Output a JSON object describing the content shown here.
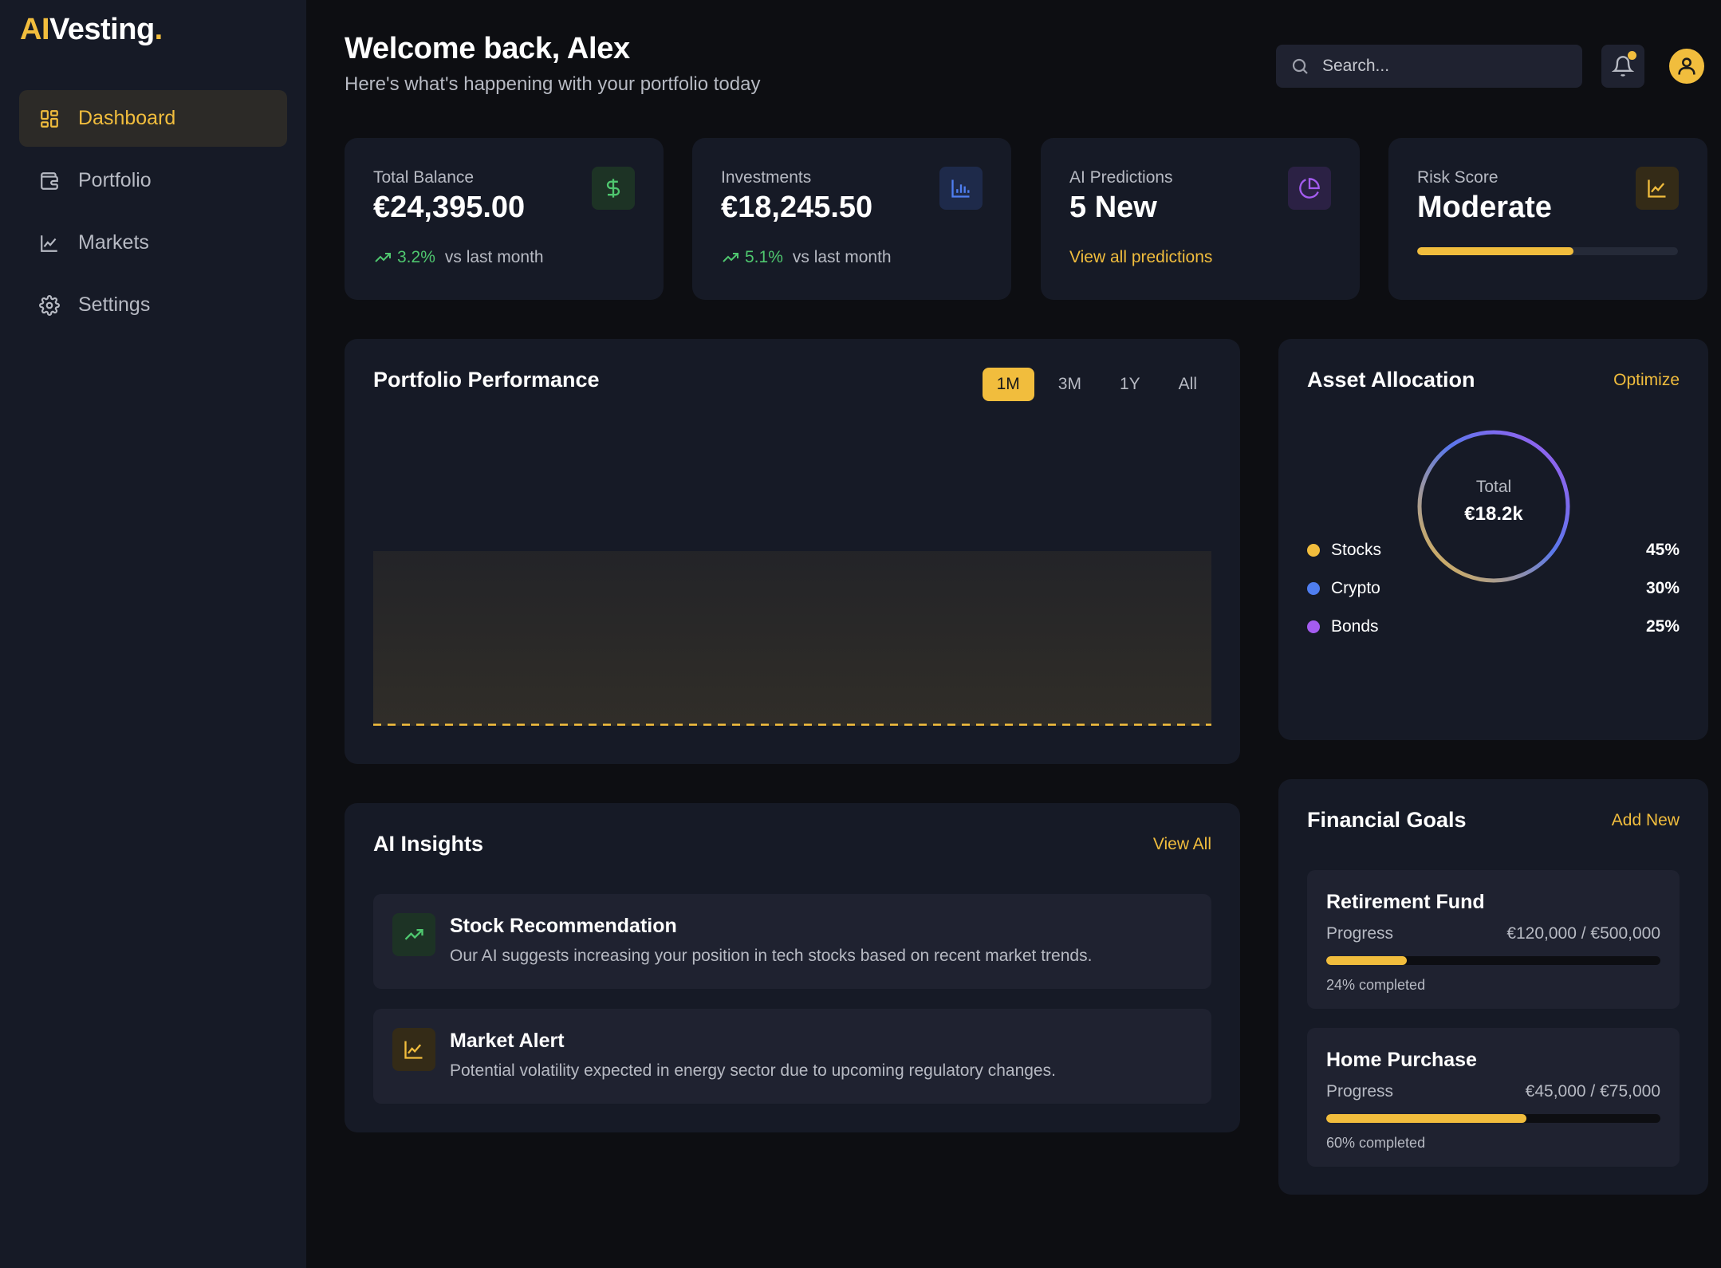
{
  "brand": {
    "prefix": "AI",
    "name": "Vesting",
    "dot": "."
  },
  "nav": {
    "items": [
      {
        "label": "Dashboard",
        "icon": "grid-icon",
        "active": true
      },
      {
        "label": "Portfolio",
        "icon": "wallet-icon",
        "active": false
      },
      {
        "label": "Markets",
        "icon": "line-chart-icon",
        "active": false
      },
      {
        "label": "Settings",
        "icon": "gear-icon",
        "active": false
      }
    ]
  },
  "header": {
    "title": "Welcome back, Alex",
    "subtitle": "Here's what's happening with your portfolio today",
    "search_placeholder": "Search...",
    "has_notification": true
  },
  "stats": {
    "balance": {
      "label": "Total Balance",
      "value": "€24,395.00",
      "change": "3.2%",
      "change_text": "vs last month",
      "icon": "dollar-icon"
    },
    "investments": {
      "label": "Investments",
      "value": "€18,245.50",
      "change": "5.1%",
      "change_text": "vs last month",
      "icon": "bar-chart-icon"
    },
    "predictions": {
      "label": "AI Predictions",
      "value": "5 New",
      "link": "View all predictions",
      "icon": "pie-chart-icon"
    },
    "risk": {
      "label": "Risk Score",
      "value": "Moderate",
      "level": 0.6,
      "icon": "line-chart-icon"
    }
  },
  "performance": {
    "title": "Portfolio Performance",
    "ranges": [
      "1M",
      "3M",
      "1Y",
      "All"
    ],
    "active_range": "1M"
  },
  "insights": {
    "title": "AI Insights",
    "link": "View All",
    "items": [
      {
        "title": "Stock Recommendation",
        "text": "Our AI suggests increasing your position in tech stocks based on recent market trends.",
        "icon": "trend-up-icon"
      },
      {
        "title": "Market Alert",
        "text": "Potential volatility expected in energy sector due to upcoming regulatory changes.",
        "icon": "line-chart-icon"
      }
    ]
  },
  "allocation": {
    "title": "Asset Allocation",
    "link": "Optimize",
    "center_label": "Total",
    "center_value": "€18.2k",
    "items": [
      {
        "name": "Stocks",
        "pct": "45%",
        "color": "#f1bd3d"
      },
      {
        "name": "Crypto",
        "pct": "30%",
        "color": "#4f7ef0"
      },
      {
        "name": "Bonds",
        "pct": "25%",
        "color": "#a45cf0"
      }
    ]
  },
  "goals": {
    "title": "Financial Goals",
    "link": "Add New",
    "items": [
      {
        "title": "Retirement Fund",
        "progress_label": "Progress",
        "amount": "€120,000 / €500,000",
        "progress": 0.24,
        "completed_text": "24% completed"
      },
      {
        "title": "Home Purchase",
        "progress_label": "Progress",
        "amount": "€45,000 / €75,000",
        "progress": 0.6,
        "completed_text": "60% completed"
      }
    ]
  },
  "colors": {
    "accent": "#f1bd3d",
    "positive": "#4fc76f",
    "blue": "#4f7ef0",
    "purple": "#a45cf0",
    "card_bg": "#161a26",
    "page_bg": "#0d0e12"
  }
}
